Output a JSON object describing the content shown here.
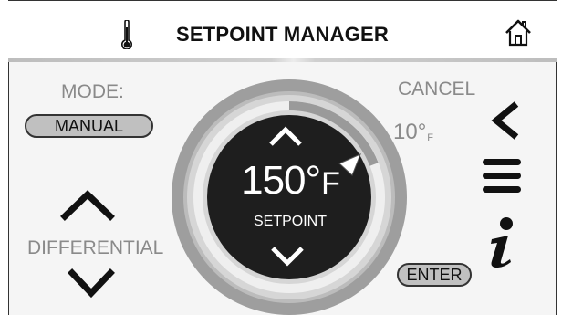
{
  "header": {
    "title": "SETPOINT MANAGER",
    "thermometer_icon": "thermometer-icon",
    "home_icon": "home-icon"
  },
  "mode": {
    "label": "MODE:",
    "value": "MANUAL"
  },
  "differential": {
    "label": "DIFFERENTIAL",
    "value": "10°",
    "unit": "F",
    "up_icon": "chevron-up-icon",
    "down_icon": "chevron-down-icon"
  },
  "setpoint": {
    "value": "150°",
    "unit": "F",
    "label": "SETPOINT",
    "up_icon": "chevron-up-icon",
    "down_icon": "chevron-down-icon"
  },
  "actions": {
    "cancel_label": "CANCEL",
    "back_icon": "chevron-left-icon",
    "menu_icon": "hamburger-menu-icon",
    "info_icon": "info-icon",
    "enter_label": "ENTER"
  },
  "colors": {
    "accent": "#1e1e1e",
    "muted_text": "#8a8a8a",
    "pill_fill": "#c0c0c0",
    "dial_ring": "#9e9e9e"
  }
}
